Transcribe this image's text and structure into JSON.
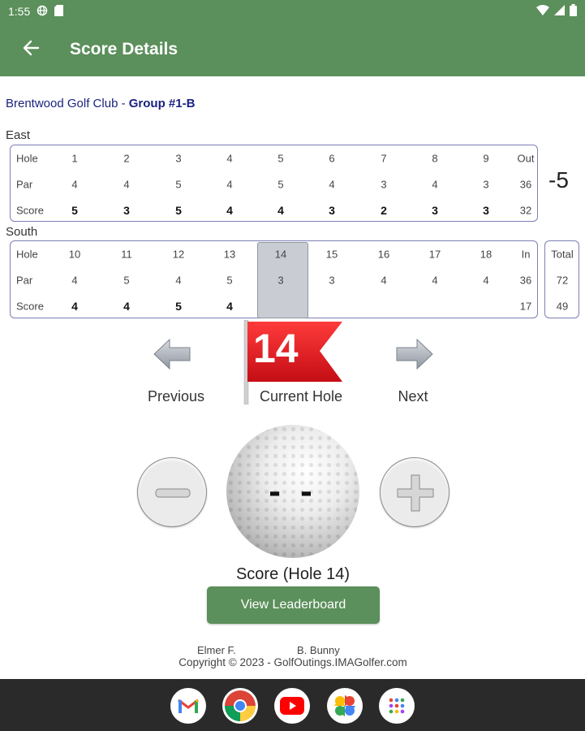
{
  "status_bar": {
    "time": "1:55",
    "icons": [
      "vpn-globe-icon",
      "sim-card-icon",
      "wifi-icon",
      "signal-icon",
      "battery-icon"
    ]
  },
  "app_bar": {
    "title": "Score Details",
    "back_icon": "arrow-left-icon"
  },
  "club": {
    "name": "Brentwood Golf Club",
    "separator": " - ",
    "group": "Group #1-B"
  },
  "front_nine": {
    "label": "East",
    "row_labels": [
      "Hole",
      "Par",
      "Score"
    ],
    "holes": [
      "1",
      "2",
      "3",
      "4",
      "5",
      "6",
      "7",
      "8",
      "9"
    ],
    "par": [
      "4",
      "4",
      "5",
      "4",
      "5",
      "4",
      "3",
      "4",
      "3"
    ],
    "score": [
      "5",
      "3",
      "5",
      "4",
      "4",
      "3",
      "2",
      "3",
      "3"
    ],
    "sub_label": "Out",
    "par_total": "36",
    "score_total": "32"
  },
  "back_nine": {
    "label": "South",
    "row_labels": [
      "Hole",
      "Par",
      "Score"
    ],
    "holes": [
      "10",
      "11",
      "12",
      "13",
      "14",
      "15",
      "16",
      "17",
      "18"
    ],
    "par": [
      "4",
      "5",
      "4",
      "5",
      "3",
      "3",
      "4",
      "4",
      "4"
    ],
    "score": [
      "4",
      "4",
      "5",
      "4",
      "",
      "",
      "",
      "",
      ""
    ],
    "sub_label": "In",
    "par_total": "36",
    "score_total": "17"
  },
  "totals": {
    "label": "Total",
    "par": "72",
    "score": "49",
    "to_par": "-5"
  },
  "navigation": {
    "previous_label": "Previous",
    "current_label": "Current Hole",
    "next_label": "Next",
    "current_hole": "14"
  },
  "scoring": {
    "value": "- -",
    "caption": "Score (Hole 14)"
  },
  "leaderboard_button": "View Leaderboard",
  "players": [
    "Elmer F.",
    "B. Bunny"
  ],
  "copyright": "Copyright © 2023 - GolfOutings.IMAGolfer.com",
  "dock_apps": [
    "gmail-icon",
    "chrome-icon",
    "youtube-icon",
    "photos-icon",
    "app-drawer-icon"
  ],
  "colors": {
    "primary_green": "#5b8f5b",
    "club_blue": "#1a237e",
    "flag_red": "#e41e26",
    "highlight_grey": "#c9cdd3"
  }
}
